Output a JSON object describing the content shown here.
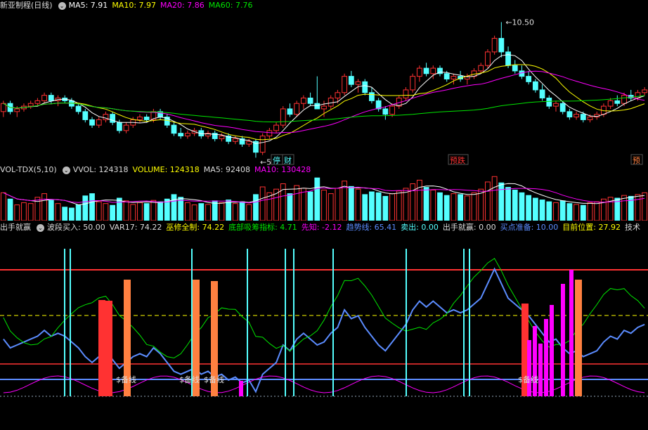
{
  "colors": {
    "up": "#ff3232",
    "down": "#54ffff",
    "ma5": "#ffffff",
    "ma10": "#ffff00",
    "ma20": "#ff00ff",
    "ma60": "#00e600",
    "label_green": "#00e600",
    "label_cyan": "#54ffff",
    "label_yellow": "#ffff00",
    "label_magenta": "#ff00ff",
    "label_white": "#dddddd",
    "label_orange": "#ff8040",
    "label_red": "#ff3232",
    "label_blue": "#5b8cff"
  },
  "price_panel": {
    "title": "新亚制程(日线)",
    "indicators": [
      {
        "label": "MA5: 7.91",
        "color_key": "ma5"
      },
      {
        "label": "MA10: 7.97",
        "color_key": "ma10"
      },
      {
        "label": "MA20: 7.86",
        "color_key": "ma20"
      },
      {
        "label": "MA60: 7.76",
        "color_key": "ma60"
      }
    ],
    "high_label": "10.50",
    "low_label": "5.46",
    "markers": [
      {
        "text": "停",
        "color_key": "label_cyan"
      },
      {
        "text": "财",
        "color_key": "label_cyan"
      },
      {
        "text": "预跌",
        "color_key": "label_red"
      },
      {
        "text": "预",
        "color_key": "label_orange"
      }
    ]
  },
  "volume_panel": {
    "title": "VOL-TDX(5,10)",
    "indicators": [
      {
        "label": "VVOL: 124318",
        "color_key": "label_white"
      },
      {
        "label": "VOLUME: 124318",
        "color_key": "label_yellow"
      },
      {
        "label": "MA5: 92408",
        "color_key": "label_white"
      },
      {
        "label": "MA10: 130428",
        "color_key": "label_magenta"
      }
    ]
  },
  "signal_panel": {
    "title": "出手就赢",
    "indicators": [
      {
        "label": "波段买入: 50.00",
        "color_key": "label_white"
      },
      {
        "label": "VAR17: 74.22",
        "color_key": "label_white"
      },
      {
        "label": "巫修全制: 74.22",
        "color_key": "label_yellow"
      },
      {
        "label": "底部吸筹指标: 4.71",
        "color_key": "label_green"
      },
      {
        "label": "先知: -2.12",
        "color_key": "label_magenta"
      },
      {
        "label": "趋势线: 65.41",
        "color_key": "label_blue"
      },
      {
        "label": "卖出: 0.00",
        "color_key": "label_cyan"
      },
      {
        "label": "出手就赢: 0.00",
        "color_key": "label_white"
      },
      {
        "label": "买点准备: 10.00",
        "color_key": "label_blue"
      },
      {
        "label": "目前位置: 27.92",
        "color_key": "label_yellow"
      },
      {
        "label": "技术",
        "color_key": "label_white"
      }
    ],
    "annotations": [
      {
        "text": "$备线",
        "color_key": "label_white"
      },
      {
        "text": "$备线",
        "color_key": "label_white"
      },
      {
        "text": "$备线",
        "color_key": "label_white"
      },
      {
        "text": "$备线",
        "color_key": "label_white"
      }
    ]
  },
  "chart_data": {
    "type": "candlestick",
    "ylim": [
      5.2,
      10.9
    ],
    "candles": [
      [
        7.2,
        7.6,
        7.0,
        7.5
      ],
      [
        7.5,
        7.6,
        7.1,
        7.2
      ],
      [
        7.2,
        7.4,
        7.0,
        7.3
      ],
      [
        7.3,
        7.5,
        7.2,
        7.4
      ],
      [
        7.4,
        7.6,
        7.3,
        7.5
      ],
      [
        7.5,
        7.7,
        7.4,
        7.6
      ],
      [
        7.6,
        7.9,
        7.5,
        7.8
      ],
      [
        7.8,
        7.9,
        7.5,
        7.6
      ],
      [
        7.6,
        7.8,
        7.4,
        7.7
      ],
      [
        7.7,
        7.8,
        7.5,
        7.6
      ],
      [
        7.6,
        7.7,
        7.3,
        7.4
      ],
      [
        7.4,
        7.5,
        7.1,
        7.2
      ],
      [
        7.2,
        7.3,
        6.8,
        6.9
      ],
      [
        6.9,
        7.0,
        6.6,
        6.7
      ],
      [
        6.7,
        7.0,
        6.6,
        6.9
      ],
      [
        6.9,
        7.2,
        6.8,
        7.1
      ],
      [
        7.1,
        7.2,
        6.7,
        6.8
      ],
      [
        6.8,
        6.9,
        6.4,
        6.5
      ],
      [
        6.5,
        6.8,
        6.4,
        6.7
      ],
      [
        6.7,
        7.0,
        6.6,
        6.9
      ],
      [
        6.9,
        7.1,
        6.8,
        7.0
      ],
      [
        7.0,
        7.1,
        6.8,
        6.9
      ],
      [
        6.9,
        7.3,
        6.8,
        7.2
      ],
      [
        7.2,
        7.3,
        6.9,
        7.0
      ],
      [
        7.0,
        7.1,
        6.6,
        6.7
      ],
      [
        6.7,
        6.8,
        6.3,
        6.4
      ],
      [
        6.4,
        6.6,
        6.2,
        6.3
      ],
      [
        6.3,
        6.5,
        6.2,
        6.4
      ],
      [
        6.4,
        6.6,
        6.3,
        6.5
      ],
      [
        6.5,
        6.6,
        6.2,
        6.3
      ],
      [
        6.3,
        6.5,
        6.2,
        6.4
      ],
      [
        6.4,
        6.5,
        6.1,
        6.2
      ],
      [
        6.2,
        6.4,
        6.1,
        6.3
      ],
      [
        6.3,
        6.4,
        6.0,
        6.1
      ],
      [
        6.1,
        6.3,
        6.0,
        6.2
      ],
      [
        6.2,
        6.3,
        5.9,
        6.0
      ],
      [
        6.0,
        6.2,
        5.9,
        6.1
      ],
      [
        6.1,
        6.2,
        5.5,
        5.7
      ],
      [
        5.7,
        6.4,
        5.6,
        6.3
      ],
      [
        6.3,
        6.6,
        6.2,
        6.5
      ],
      [
        6.5,
        6.8,
        6.4,
        6.7
      ],
      [
        6.7,
        7.4,
        6.6,
        7.3
      ],
      [
        7.3,
        7.5,
        7.0,
        7.1
      ],
      [
        7.1,
        7.6,
        7.0,
        7.5
      ],
      [
        7.5,
        7.8,
        7.3,
        7.7
      ],
      [
        7.7,
        7.9,
        7.4,
        7.5
      ],
      [
        7.5,
        8.5,
        7.4,
        7.3
      ],
      [
        7.3,
        7.6,
        7.0,
        7.4
      ],
      [
        7.4,
        7.8,
        7.3,
        7.7
      ],
      [
        7.7,
        8.0,
        7.5,
        7.9
      ],
      [
        7.9,
        8.6,
        7.8,
        8.5
      ],
      [
        8.5,
        8.7,
        8.1,
        8.2
      ],
      [
        8.2,
        8.4,
        7.9,
        8.3
      ],
      [
        8.3,
        8.4,
        7.8,
        7.9
      ],
      [
        7.9,
        8.1,
        7.5,
        7.6
      ],
      [
        7.6,
        7.7,
        7.2,
        7.3
      ],
      [
        7.3,
        7.4,
        6.9,
        7.1
      ],
      [
        7.1,
        7.5,
        7.0,
        7.4
      ],
      [
        7.4,
        7.8,
        7.3,
        7.7
      ],
      [
        7.7,
        8.1,
        7.6,
        8.0
      ],
      [
        8.0,
        8.6,
        7.9,
        8.5
      ],
      [
        8.5,
        8.9,
        8.3,
        8.8
      ],
      [
        8.8,
        9.0,
        8.5,
        8.6
      ],
      [
        8.6,
        8.9,
        8.4,
        8.8
      ],
      [
        8.8,
        8.9,
        8.5,
        8.6
      ],
      [
        8.6,
        8.7,
        8.3,
        8.4
      ],
      [
        8.4,
        8.6,
        8.2,
        8.5
      ],
      [
        8.5,
        8.7,
        8.3,
        8.4
      ],
      [
        8.4,
        8.6,
        8.2,
        8.5
      ],
      [
        8.5,
        8.8,
        8.4,
        8.7
      ],
      [
        8.7,
        9.0,
        8.6,
        8.9
      ],
      [
        8.9,
        9.5,
        8.8,
        9.4
      ],
      [
        9.4,
        10.0,
        9.3,
        9.9
      ],
      [
        9.9,
        10.5,
        9.2,
        9.4
      ],
      [
        9.4,
        9.6,
        8.8,
        8.9
      ],
      [
        8.9,
        9.1,
        8.6,
        8.7
      ],
      [
        8.7,
        8.9,
        8.4,
        8.5
      ],
      [
        8.5,
        8.7,
        8.2,
        8.3
      ],
      [
        8.3,
        8.4,
        7.9,
        8.0
      ],
      [
        8.0,
        8.2,
        7.6,
        7.7
      ],
      [
        7.7,
        7.8,
        7.3,
        7.4
      ],
      [
        7.4,
        7.6,
        7.2,
        7.5
      ],
      [
        7.5,
        7.6,
        7.1,
        7.2
      ],
      [
        7.2,
        7.3,
        6.9,
        7.0
      ],
      [
        7.0,
        7.2,
        6.9,
        7.1
      ],
      [
        7.1,
        7.2,
        6.8,
        6.9
      ],
      [
        6.9,
        7.1,
        6.8,
        7.0
      ],
      [
        7.0,
        7.2,
        6.9,
        7.1
      ],
      [
        7.1,
        7.5,
        7.0,
        7.4
      ],
      [
        7.4,
        7.7,
        7.3,
        7.6
      ],
      [
        7.6,
        7.8,
        7.4,
        7.5
      ],
      [
        7.5,
        7.9,
        7.4,
        7.8
      ],
      [
        7.8,
        8.0,
        7.6,
        7.7
      ],
      [
        7.7,
        8.0,
        7.6,
        7.9
      ],
      [
        7.9,
        8.1,
        7.8,
        8.0
      ]
    ],
    "volumes": [
      62,
      48,
      35,
      40,
      38,
      52,
      60,
      45,
      38,
      30,
      28,
      35,
      55,
      60,
      42,
      38,
      34,
      50,
      44,
      36,
      40,
      38,
      45,
      42,
      48,
      58,
      52,
      40,
      35,
      38,
      36,
      44,
      40,
      46,
      38,
      42,
      36,
      58,
      75,
      62,
      70,
      82,
      60,
      78,
      72,
      64,
      95,
      68,
      60,
      72,
      88,
      76,
      70,
      58,
      64,
      62,
      54,
      60,
      66,
      72,
      82,
      90,
      74,
      68,
      62,
      56,
      60,
      58,
      55,
      62,
      70,
      86,
      98,
      84,
      74,
      68,
      62,
      56,
      50,
      46,
      42,
      40,
      44,
      38,
      36,
      34,
      40,
      42,
      48,
      52,
      50,
      56,
      54,
      58,
      62
    ]
  }
}
